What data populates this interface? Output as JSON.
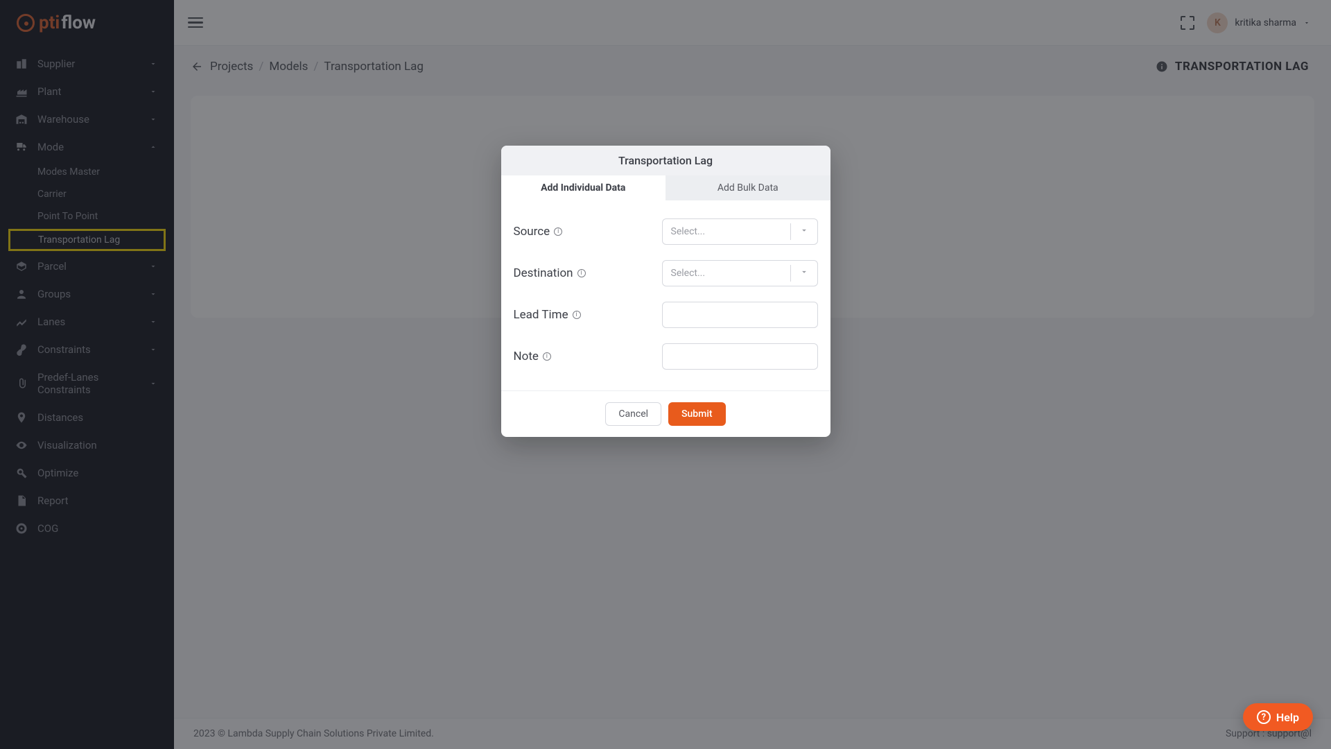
{
  "brand": {
    "part1": "pti",
    "part2": "flow"
  },
  "sidebar": {
    "items": [
      {
        "label": "Supplier",
        "expandable": true
      },
      {
        "label": "Plant",
        "expandable": true
      },
      {
        "label": "Warehouse",
        "expandable": true
      },
      {
        "label": "Mode",
        "expandable": true,
        "open": true,
        "children": [
          "Modes Master",
          "Carrier",
          "Point To Point",
          "Transportation Lag"
        ]
      },
      {
        "label": "Parcel",
        "expandable": true
      },
      {
        "label": "Groups",
        "expandable": true
      },
      {
        "label": "Lanes",
        "expandable": true
      },
      {
        "label": "Constraints",
        "expandable": true
      },
      {
        "label": "Predef-Lanes Constraints",
        "expandable": true
      },
      {
        "label": "Distances"
      },
      {
        "label": "Visualization"
      },
      {
        "label": "Optimize"
      },
      {
        "label": "Report"
      },
      {
        "label": "COG"
      }
    ]
  },
  "user": {
    "initial": "K",
    "name": "kritika sharma"
  },
  "breadcrumbs": [
    "Projects",
    "Models",
    "Transportation Lag"
  ],
  "page_title": "TRANSPORTATION LAG",
  "modal": {
    "title": "Transportation Lag",
    "tabs": [
      "Add Individual Data",
      "Add Bulk Data"
    ],
    "fields": {
      "source_label": "Source",
      "destination_label": "Destination",
      "lead_time_label": "Lead Time",
      "note_label": "Note",
      "select_placeholder": "Select..."
    },
    "buttons": {
      "cancel": "Cancel",
      "submit": "Submit"
    }
  },
  "footer": {
    "copyright": "2023 © Lambda Supply Chain Solutions Private Limited.",
    "support_prefix": "Support : support@l"
  },
  "help_label": "Help"
}
